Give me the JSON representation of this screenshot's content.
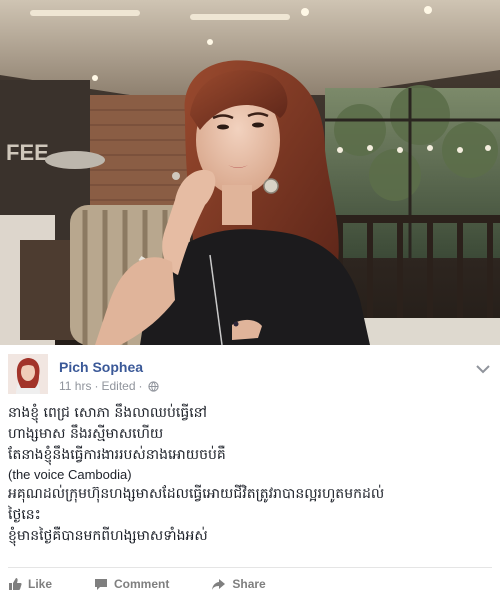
{
  "post": {
    "author": "Pich Sophea",
    "timestamp": "11 hrs",
    "edited_label": "Edited",
    "separator": "·",
    "privacy_icon": "globe-icon",
    "options_icon": "chevron-down-icon",
    "text_lines": [
      "នាងខ្ញុំ ពេជ្រ សោភា នឹងលាឈប់ធ្វើនៅ",
      "ហាង្សមាស នឹងរស្មីមាសហើយ",
      "តែនាងខ្ញុំនឹងធ្វើការងាររបស់នាងអោយចប់គឺ",
      "(the voice Cambodia)",
      "អគុណដល់ក្រុមហ៊ុនហង្សមាសដែលធ្វើអោយជីវិតត្រូវរាបានល្អរហូតមកដល់",
      "ថ្ងៃនេះ",
      "ខ្ញុំមានថ្ងៃគឺបានមកពីហង្សមាសទាំងអស់"
    ]
  },
  "actions": {
    "like_label": "Like",
    "comment_label": "Comment",
    "share_label": "Share",
    "like_icon": "thumbs-up-icon",
    "comment_icon": "comment-icon",
    "share_icon": "share-icon"
  },
  "colors": {
    "author_link": "#3b5998",
    "meta_text": "#90949c",
    "action_text": "#7f7f7f",
    "body_text": "#1d2129"
  }
}
